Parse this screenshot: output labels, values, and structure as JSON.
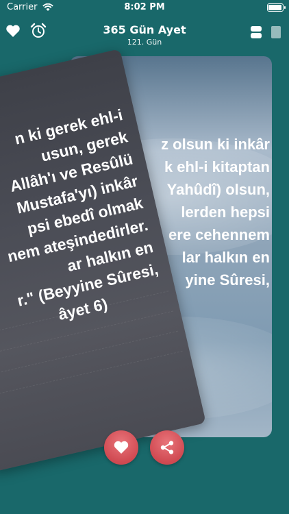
{
  "status_bar": {
    "carrier": "Carrier",
    "time": "8:02 PM"
  },
  "nav": {
    "title": "365 Gün Ayet",
    "subtitle": "121. Gün",
    "left_icons": [
      "heart-icon",
      "alarm-clock-icon"
    ],
    "right_icons": [
      "toggle-layout-icon",
      "page-icon"
    ]
  },
  "back_card": {
    "lines": [
      "z olsun ki inkâr",
      "k ehl-i kitaptan",
      "Yahûdî) olsun,",
      "lerden hepsi",
      "ere cehennem",
      "lar halkın en",
      "yine Sûresi,"
    ]
  },
  "front_card": {
    "lines": [
      "n ki gerek ehl-i",
      "usun, gerek",
      "Allâh'ı ve Resûlü",
      "Mustafa'yı) inkâr",
      "psi ebedî olmak",
      "nem ateşindedirler.",
      "ar halkın en",
      "r.\" (Beyyine Sûresi,",
      "âyet 6)"
    ]
  },
  "actions": {
    "favorite_icon": "heart-icon",
    "share_icon": "share-icon"
  },
  "colors": {
    "background": "#19686a",
    "button": "#d04a52"
  }
}
